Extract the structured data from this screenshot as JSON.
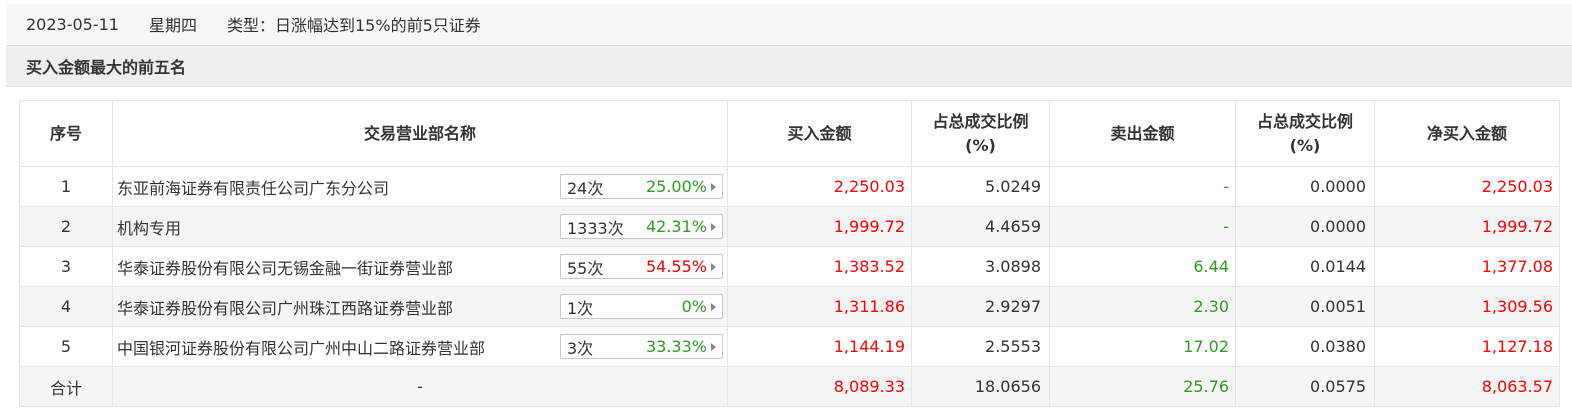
{
  "header": {
    "date": "2023-05-11",
    "weekday": "星期四",
    "type": "类型：日涨幅达到15%的前5只证券"
  },
  "section_title": "买入金额最大的前五名",
  "columns": {
    "idx": "序号",
    "name": "交易营业部名称",
    "buy": "买入金额",
    "buy_ratio_l1": "占总成交比例",
    "buy_ratio_l2": "(%)",
    "sell": "卖出金额",
    "sell_ratio_l1": "占总成交比例",
    "sell_ratio_l2": "(%)",
    "net": "净买入金额"
  },
  "rows": [
    {
      "idx": "1",
      "name": "东亚前海证券有限责任公司广东分公司",
      "count": "24次",
      "pct": "25.00%",
      "pct_color": "#2d9c1f",
      "buy": "2,250.03",
      "buy_ratio": "5.0249",
      "sell": "-",
      "sell_ratio": "0.0000",
      "net": "2,250.03"
    },
    {
      "idx": "2",
      "name": "机构专用",
      "count": "1333次",
      "pct": "42.31%",
      "pct_color": "#2d9c1f",
      "buy": "1,999.72",
      "buy_ratio": "4.4659",
      "sell": "-",
      "sell_ratio": "0.0000",
      "net": "1,999.72"
    },
    {
      "idx": "3",
      "name": "华泰证券股份有限公司无锡金融一街证券营业部",
      "count": "55次",
      "pct": "54.55%",
      "pct_color": "#f00000",
      "buy": "1,383.52",
      "buy_ratio": "3.0898",
      "sell": "6.44",
      "sell_ratio": "0.0144",
      "net": "1,377.08"
    },
    {
      "idx": "4",
      "name": "华泰证券股份有限公司广州珠江西路证券营业部",
      "count": "1次",
      "pct": "0%",
      "pct_color": "#2d9c1f",
      "buy": "1,311.86",
      "buy_ratio": "2.9297",
      "sell": "2.30",
      "sell_ratio": "0.0051",
      "net": "1,309.56"
    },
    {
      "idx": "5",
      "name": "中国银河证券股份有限公司广州中山二路证券营业部",
      "count": "3次",
      "pct": "33.33%",
      "pct_color": "#2d9c1f",
      "buy": "1,144.19",
      "buy_ratio": "2.5553",
      "sell": "17.02",
      "sell_ratio": "0.0380",
      "net": "1,127.18"
    }
  ],
  "total": {
    "label": "合计",
    "name": "-",
    "buy": "8,089.33",
    "buy_ratio": "18.0656",
    "sell": "25.76",
    "sell_ratio": "0.0575",
    "net": "8,063.57"
  },
  "colors": {
    "buy": "#f00000",
    "sell": "#2d9c1f",
    "net": "#f00000"
  }
}
